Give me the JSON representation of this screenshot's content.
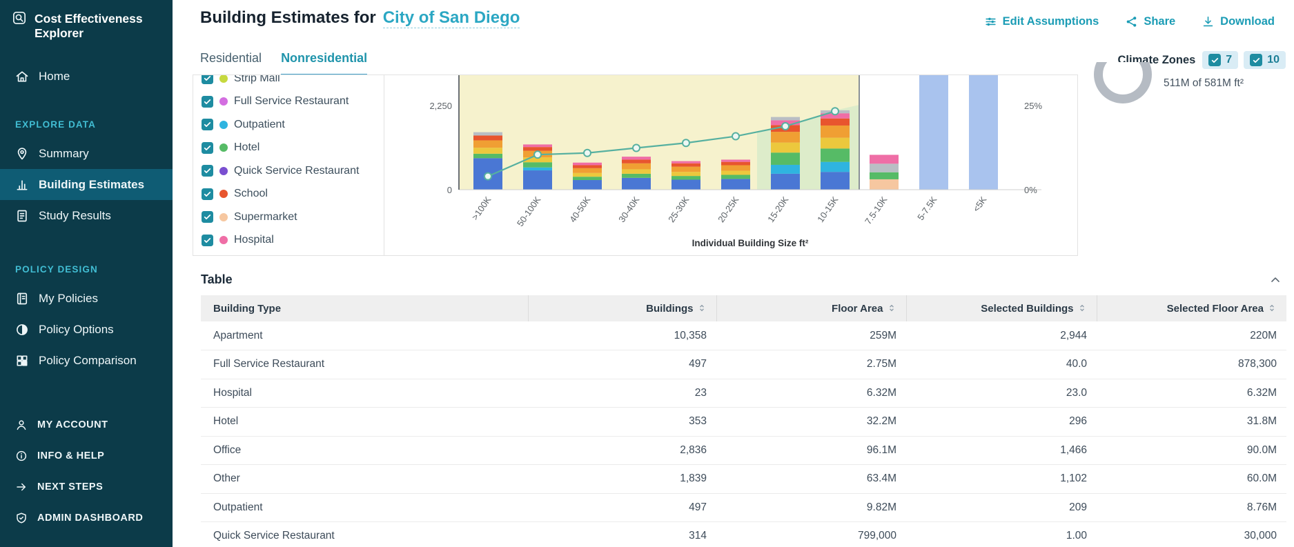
{
  "sidebar": {
    "logo": {
      "line1": "Cost Effectiveness",
      "line2": "Explorer"
    },
    "home": {
      "label": "Home",
      "icon": "home-icon",
      "active": false
    },
    "sections": [
      {
        "header": "EXPLORE DATA",
        "items": [
          {
            "label": "Summary",
            "icon": "location-pin-icon",
            "active": false
          },
          {
            "label": "Building Estimates",
            "icon": "bar-chart-icon",
            "active": true
          },
          {
            "label": "Study Results",
            "icon": "report-icon",
            "active": false
          }
        ]
      },
      {
        "header": "POLICY DESIGN",
        "items": [
          {
            "label": "My Policies",
            "icon": "notebook-icon",
            "active": false
          },
          {
            "label": "Policy Options",
            "icon": "contrast-circle-icon",
            "active": false
          },
          {
            "label": "Policy Comparison",
            "icon": "grid-icon",
            "active": false
          }
        ]
      }
    ],
    "footer_items": [
      {
        "label": "MY ACCOUNT",
        "icon": "user-icon"
      },
      {
        "label": "INFO & HELP",
        "icon": "info-icon"
      },
      {
        "label": "NEXT STEPS",
        "icon": "arrow-right-icon"
      },
      {
        "label": "ADMIN DASHBOARD",
        "icon": "admin-shield-icon"
      }
    ],
    "colors": {
      "bg": "#0c3b49",
      "active_bg": "#0f5c74",
      "section_header": "#41bdd3"
    }
  },
  "header": {
    "title": "Building Estimates for",
    "jurisdiction": "City of San Diego",
    "accent_color": "#1b9cb5",
    "actions": [
      {
        "label": "Edit Assumptions",
        "icon": "sliders-icon"
      },
      {
        "label": "Share",
        "icon": "share-icon"
      },
      {
        "label": "Download",
        "icon": "download-icon"
      }
    ]
  },
  "tabs": [
    {
      "label": "Residential",
      "active": false
    },
    {
      "label": "Nonresidential",
      "active": true
    }
  ],
  "climate_zones": {
    "label": "Climate Zones",
    "zones": [
      {
        "value": "7",
        "checked": true
      },
      {
        "value": "10",
        "checked": true
      }
    ]
  },
  "legend": [
    {
      "label": "Strip Mall",
      "color": "#c6d93f",
      "checked": true
    },
    {
      "label": "Full Service Restaurant",
      "color": "#d36ee0",
      "checked": true
    },
    {
      "label": "Outpatient",
      "color": "#2fb4e0",
      "checked": true
    },
    {
      "label": "Hotel",
      "color": "#56bb66",
      "checked": true
    },
    {
      "label": "Quick Service Restaurant",
      "color": "#7a4fd0",
      "checked": true
    },
    {
      "label": "School",
      "color": "#e8552e",
      "checked": true
    },
    {
      "label": "Supermarket",
      "color": "#f6c7a0",
      "checked": true
    },
    {
      "label": "Hospital",
      "color": "#ef6ea6",
      "checked": true
    }
  ],
  "stats": {
    "floor_area_summary": "511M of 581M ft²"
  },
  "chart_data": {
    "type": "stacked-bar-with-cumulative-line",
    "xlabel": "Individual Building Size ft²",
    "categories": [
      ">100K",
      "50-100K",
      "40-50K",
      "30-40K",
      "25-30K",
      "20-25K",
      "15-20K",
      "10-15K",
      "7.5-10K",
      "5-7.5K",
      "<5K"
    ],
    "y_left_axis": {
      "tick_labels": [
        "2,250",
        "0"
      ],
      "visible_max": 2250
    },
    "y_right_axis": {
      "tick_labels": [
        "25%",
        "0%"
      ],
      "visible_max_pct": 25
    },
    "highlighted_bar_color": "#a9c3ee",
    "selected_categories": [
      "5-7.5K",
      "<5K"
    ],
    "threshold_after_category": "10-15K",
    "bars": [
      {
        "category": ">100K",
        "segments": [
          [
            "#4a77d4",
            850
          ],
          [
            "#56bb66",
            120
          ],
          [
            "#ecc83d",
            160
          ],
          [
            "#f09f33",
            200
          ],
          [
            "#e8552e",
            130
          ],
          [
            "#b9bec4",
            90
          ]
        ]
      },
      {
        "category": "50-100K",
        "segments": [
          [
            "#4a77d4",
            520
          ],
          [
            "#2fb4e0",
            80
          ],
          [
            "#56bb66",
            140
          ],
          [
            "#ecc83d",
            130
          ],
          [
            "#f09f33",
            180
          ],
          [
            "#e8552e",
            100
          ],
          [
            "#ef6ea6",
            70
          ]
        ]
      },
      {
        "category": "40-50K",
        "segments": [
          [
            "#4a77d4",
            260
          ],
          [
            "#56bb66",
            90
          ],
          [
            "#ecc83d",
            100
          ],
          [
            "#f09f33",
            130
          ],
          [
            "#e8552e",
            80
          ],
          [
            "#ef6ea6",
            70
          ]
        ]
      },
      {
        "category": "30-40K",
        "segments": [
          [
            "#4a77d4",
            320
          ],
          [
            "#56bb66",
            110
          ],
          [
            "#ecc83d",
            120
          ],
          [
            "#f09f33",
            160
          ],
          [
            "#e8552e",
            100
          ],
          [
            "#ef6ea6",
            80
          ]
        ]
      },
      {
        "category": "25-30K",
        "segments": [
          [
            "#4a77d4",
            270
          ],
          [
            "#56bb66",
            100
          ],
          [
            "#ecc83d",
            110
          ],
          [
            "#f09f33",
            140
          ],
          [
            "#e8552e",
            90
          ],
          [
            "#ef6ea6",
            60
          ]
        ]
      },
      {
        "category": "20-25K",
        "segments": [
          [
            "#4a77d4",
            290
          ],
          [
            "#56bb66",
            110
          ],
          [
            "#ecc83d",
            110
          ],
          [
            "#f09f33",
            150
          ],
          [
            "#e8552e",
            90
          ],
          [
            "#ef6ea6",
            60
          ]
        ]
      },
      {
        "category": "15-20K",
        "segments": [
          [
            "#4a77d4",
            430
          ],
          [
            "#2fb4e0",
            240
          ],
          [
            "#56bb66",
            330
          ],
          [
            "#ecc83d",
            270
          ],
          [
            "#f09f33",
            290
          ],
          [
            "#e8552e",
            180
          ],
          [
            "#ef6ea6",
            130
          ],
          [
            "#b9bec4",
            90
          ]
        ]
      },
      {
        "category": "10-15K",
        "segments": [
          [
            "#4a77d4",
            480
          ],
          [
            "#2fb4e0",
            270
          ],
          [
            "#56bb66",
            360
          ],
          [
            "#ecc83d",
            290
          ],
          [
            "#f09f33",
            330
          ],
          [
            "#e8552e",
            190
          ],
          [
            "#ef6ea6",
            140
          ],
          [
            "#b9bec4",
            80
          ]
        ]
      },
      {
        "category": "7.5-10K",
        "segments": [
          [
            "#f6c7a0",
            280
          ],
          [
            "#56bb66",
            190
          ],
          [
            "#b9bec4",
            230
          ],
          [
            "#ef6ea6",
            240
          ]
        ]
      },
      {
        "category": "5-7.5K",
        "segments": [
          [
            "#a9c3ee",
            3300
          ]
        ]
      },
      {
        "category": "<5K",
        "segments": [
          [
            "#a9c3ee",
            3300
          ]
        ]
      }
    ],
    "line": {
      "color": "#56b0a0",
      "values_pct": [
        4,
        10.5,
        11,
        12.5,
        14,
        16,
        19,
        23.5,
        null,
        null,
        null
      ]
    },
    "shaded_regions": [
      {
        "kind": "left-of-threshold",
        "color": "#f6f2cd"
      },
      {
        "kind": "under-line-near-threshold",
        "color": "#d3e9c9"
      }
    ]
  },
  "table": {
    "title": "Table",
    "columns": [
      {
        "label": "Building Type",
        "sortable": false
      },
      {
        "label": "Buildings",
        "sortable": true
      },
      {
        "label": "Floor Area",
        "sortable": true
      },
      {
        "label": "Selected Buildings",
        "sortable": true
      },
      {
        "label": "Selected Floor Area",
        "sortable": true
      }
    ],
    "rows": [
      [
        "Apartment",
        "10,358",
        "259M",
        "2,944",
        "220M"
      ],
      [
        "Full Service Restaurant",
        "497",
        "2.75M",
        "40.0",
        "878,300"
      ],
      [
        "Hospital",
        "23",
        "6.32M",
        "23.0",
        "6.32M"
      ],
      [
        "Hotel",
        "353",
        "32.2M",
        "296",
        "31.8M"
      ],
      [
        "Office",
        "2,836",
        "96.1M",
        "1,466",
        "90.0M"
      ],
      [
        "Other",
        "1,839",
        "63.4M",
        "1,102",
        "60.0M"
      ],
      [
        "Outpatient",
        "497",
        "9.82M",
        "209",
        "8.76M"
      ],
      [
        "Quick Service Restaurant",
        "314",
        "799,000",
        "1.00",
        "30,000"
      ]
    ]
  }
}
